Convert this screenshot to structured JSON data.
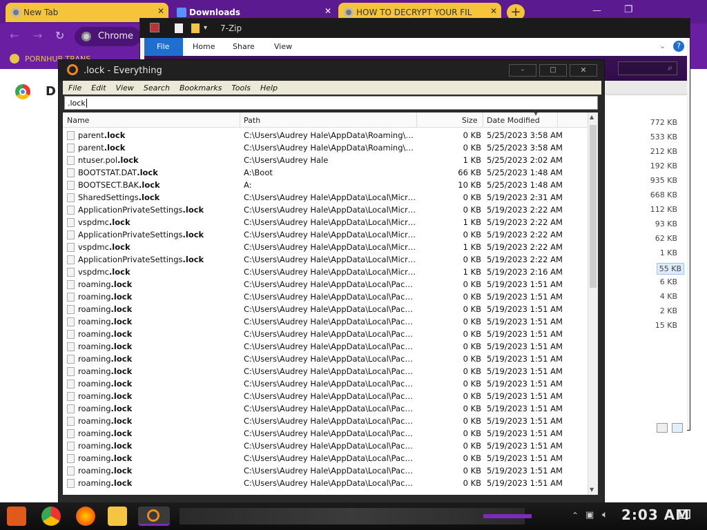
{
  "browser": {
    "tabs": [
      {
        "label": "New Tab"
      },
      {
        "label": "Downloads"
      },
      {
        "label": "HOW TO DECRYPT YOUR FIL"
      }
    ],
    "address_text": "Chrome",
    "bookmark_text": "PORNHUB TRANS",
    "page_letter": "D"
  },
  "sevenzip": {
    "title": "7-Zip",
    "ribbon": [
      "File",
      "Home",
      "Share",
      "View"
    ],
    "sizes": [
      "772 KB",
      "533 KB",
      "212 KB",
      "192 KB",
      "935 KB",
      "668 KB",
      "112 KB",
      "93 KB",
      "62 KB",
      "1 KB",
      "55 KB",
      "6 KB",
      "4 KB",
      "2 KB",
      "15 KB"
    ]
  },
  "everything": {
    "title": ".lock - Everything",
    "menu": [
      "File",
      "Edit",
      "View",
      "Search",
      "Bookmarks",
      "Tools",
      "Help"
    ],
    "search_value": ".lock",
    "columns": {
      "name": "Name",
      "path": "Path",
      "size": "Size",
      "date": "Date Modified"
    },
    "rows": [
      {
        "name_prefix": "parent",
        "name_match": ".lock",
        "path": "C:\\Users\\Audrey Hale\\AppData\\Roaming\\Mozilla...",
        "size": "0 KB",
        "date": "5/25/2023 3:58 AM"
      },
      {
        "name_prefix": "parent",
        "name_match": ".lock",
        "path": "C:\\Users\\Audrey Hale\\AppData\\Roaming\\Mozilla...",
        "size": "0 KB",
        "date": "5/25/2023 3:58 AM"
      },
      {
        "name_prefix": "ntuser.pol",
        "name_match": ".lock",
        "path": "C:\\Users\\Audrey Hale",
        "size": "1 KB",
        "date": "5/25/2023 2:02 AM"
      },
      {
        "name_prefix": "BOOTSTAT.DAT",
        "name_match": ".lock",
        "path": "A:\\Boot",
        "size": "66 KB",
        "date": "5/25/2023 1:48 AM"
      },
      {
        "name_prefix": "BOOTSECT.BAK",
        "name_match": ".lock",
        "path": "A:",
        "size": "10 KB",
        "date": "5/25/2023 1:48 AM"
      },
      {
        "name_prefix": "SharedSettings",
        "name_match": ".lock",
        "path": "C:\\Users\\Audrey Hale\\AppData\\Local\\Microsoft\\...",
        "size": "0 KB",
        "date": "5/19/2023 2:31 AM"
      },
      {
        "name_prefix": "ApplicationPrivateSettings",
        "name_match": ".lock",
        "path": "C:\\Users\\Audrey Hale\\AppData\\Local\\Microsoft\\...",
        "size": "0 KB",
        "date": "5/19/2023 2:22 AM"
      },
      {
        "name_prefix": "vspdmc",
        "name_match": ".lock",
        "path": "C:\\Users\\Audrey Hale\\AppData\\Local\\Microsoft\\...",
        "size": "1 KB",
        "date": "5/19/2023 2:22 AM"
      },
      {
        "name_prefix": "ApplicationPrivateSettings",
        "name_match": ".lock",
        "path": "C:\\Users\\Audrey Hale\\AppData\\Local\\Microsoft\\...",
        "size": "0 KB",
        "date": "5/19/2023 2:22 AM"
      },
      {
        "name_prefix": "vspdmc",
        "name_match": ".lock",
        "path": "C:\\Users\\Audrey Hale\\AppData\\Local\\Microsoft\\...",
        "size": "1 KB",
        "date": "5/19/2023 2:22 AM"
      },
      {
        "name_prefix": "ApplicationPrivateSettings",
        "name_match": ".lock",
        "path": "C:\\Users\\Audrey Hale\\AppData\\Local\\Microsoft\\...",
        "size": "0 KB",
        "date": "5/19/2023 2:22 AM"
      },
      {
        "name_prefix": "vspdmc",
        "name_match": ".lock",
        "path": "C:\\Users\\Audrey Hale\\AppData\\Local\\Microsoft\\...",
        "size": "1 KB",
        "date": "5/19/2023 2:16 AM"
      },
      {
        "name_prefix": "roaming",
        "name_match": ".lock",
        "path": "C:\\Users\\Audrey Hale\\AppData\\Local\\Packages...",
        "size": "0 KB",
        "date": "5/19/2023 1:51 AM"
      },
      {
        "name_prefix": "roaming",
        "name_match": ".lock",
        "path": "C:\\Users\\Audrey Hale\\AppData\\Local\\Packages...",
        "size": "0 KB",
        "date": "5/19/2023 1:51 AM"
      },
      {
        "name_prefix": "roaming",
        "name_match": ".lock",
        "path": "C:\\Users\\Audrey Hale\\AppData\\Local\\Packages...",
        "size": "0 KB",
        "date": "5/19/2023 1:51 AM"
      },
      {
        "name_prefix": "roaming",
        "name_match": ".lock",
        "path": "C:\\Users\\Audrey Hale\\AppData\\Local\\Packages...",
        "size": "0 KB",
        "date": "5/19/2023 1:51 AM"
      },
      {
        "name_prefix": "roaming",
        "name_match": ".lock",
        "path": "C:\\Users\\Audrey Hale\\AppData\\Local\\Packages...",
        "size": "0 KB",
        "date": "5/19/2023 1:51 AM"
      },
      {
        "name_prefix": "roaming",
        "name_match": ".lock",
        "path": "C:\\Users\\Audrey Hale\\AppData\\Local\\Packages...",
        "size": "0 KB",
        "date": "5/19/2023 1:51 AM"
      },
      {
        "name_prefix": "roaming",
        "name_match": ".lock",
        "path": "C:\\Users\\Audrey Hale\\AppData\\Local\\Packages...",
        "size": "0 KB",
        "date": "5/19/2023 1:51 AM"
      },
      {
        "name_prefix": "roaming",
        "name_match": ".lock",
        "path": "C:\\Users\\Audrey Hale\\AppData\\Local\\Packages...",
        "size": "0 KB",
        "date": "5/19/2023 1:51 AM"
      },
      {
        "name_prefix": "roaming",
        "name_match": ".lock",
        "path": "C:\\Users\\Audrey Hale\\AppData\\Local\\Packages...",
        "size": "0 KB",
        "date": "5/19/2023 1:51 AM"
      },
      {
        "name_prefix": "roaming",
        "name_match": ".lock",
        "path": "C:\\Users\\Audrey Hale\\AppData\\Local\\Packages...",
        "size": "0 KB",
        "date": "5/19/2023 1:51 AM"
      },
      {
        "name_prefix": "roaming",
        "name_match": ".lock",
        "path": "C:\\Users\\Audrey Hale\\AppData\\Local\\Packages...",
        "size": "0 KB",
        "date": "5/19/2023 1:51 AM"
      },
      {
        "name_prefix": "roaming",
        "name_match": ".lock",
        "path": "C:\\Users\\Audrey Hale\\AppData\\Local\\Packages...",
        "size": "0 KB",
        "date": "5/19/2023 1:51 AM"
      },
      {
        "name_prefix": "roaming",
        "name_match": ".lock",
        "path": "C:\\Users\\Audrey Hale\\AppData\\Local\\Packages...",
        "size": "0 KB",
        "date": "5/19/2023 1:51 AM"
      },
      {
        "name_prefix": "roaming",
        "name_match": ".lock",
        "path": "C:\\Users\\Audrey Hale\\AppData\\Local\\Packages...",
        "size": "0 KB",
        "date": "5/19/2023 1:51 AM"
      },
      {
        "name_prefix": "roaming",
        "name_match": ".lock",
        "path": "C:\\Users\\Audrey Hale\\AppData\\Local\\Packages...",
        "size": "0 KB",
        "date": "5/19/2023 1:51 AM"
      },
      {
        "name_prefix": "roaming",
        "name_match": ".lock",
        "path": "C:\\Users\\Audrey Hale\\AppData\\Local\\Packages...",
        "size": "0 KB",
        "date": "5/19/2023 1:51 AM"
      },
      {
        "name_prefix": "roaming",
        "name_match": ".lock",
        "path": "C:\\Users\\Audrey Hale\\AppData\\Local\\Packages...",
        "size": "0 KB",
        "date": "5/19/2023 1:51 AM"
      }
    ]
  },
  "taskbar": {
    "clock": "2:03 AM"
  }
}
